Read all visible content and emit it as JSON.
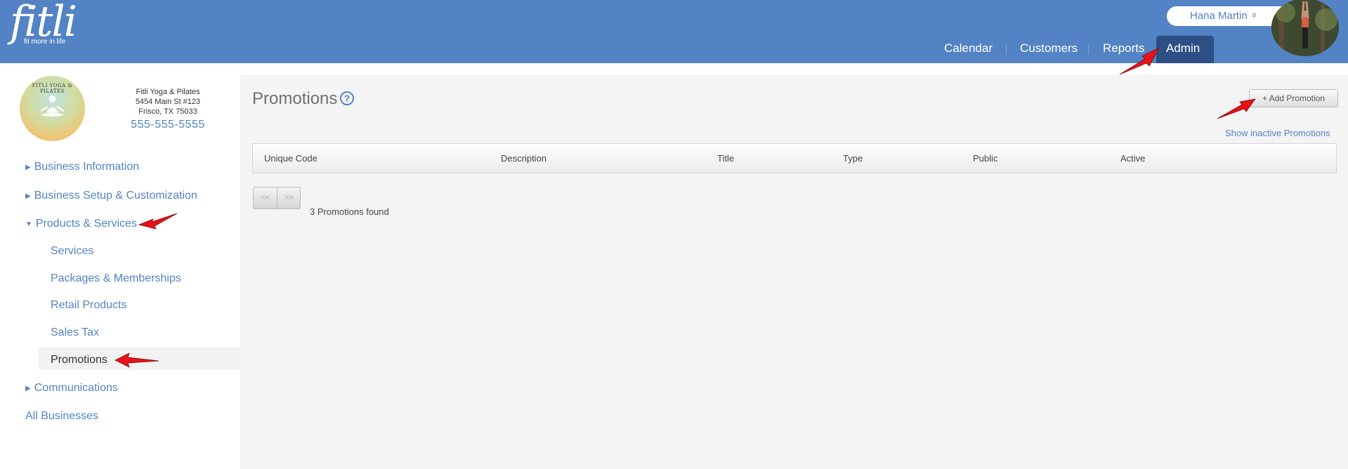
{
  "header": {
    "logo_word": "fitli",
    "logo_tagline": "fit more in life",
    "user_name": "Hana Martin",
    "user_chevron": "»",
    "nav": [
      {
        "label": "Calendar"
      },
      {
        "label": "Customers"
      },
      {
        "label": "Reports"
      },
      {
        "label": "Admin"
      }
    ]
  },
  "business": {
    "logo_text": "FITLI YOGA & PILATES",
    "name": "Fitli Yoga & Pilates",
    "address_line1": "5454 Main St #123",
    "address_line2": "Frisco, TX 75033",
    "phone": "555-555-5555"
  },
  "sidebar": {
    "items": [
      {
        "label": "Business Information"
      },
      {
        "label": "Business Setup & Customization"
      },
      {
        "label": "Products & Services"
      },
      {
        "label": "Communications"
      },
      {
        "label": "All Businesses"
      }
    ],
    "sub_items": [
      {
        "label": "Services"
      },
      {
        "label": "Packages & Memberships"
      },
      {
        "label": "Retail Products"
      },
      {
        "label": "Sales Tax"
      },
      {
        "label": "Promotions"
      }
    ]
  },
  "main": {
    "title": "Promotions",
    "help_glyph": "?",
    "add_button": "+ Add Promotion",
    "inactive_link": "Show inactive Promotions",
    "columns": [
      "Unique Code",
      "Description",
      "Title",
      "Type",
      "Public",
      "Active"
    ],
    "pager_prev": "<<",
    "pager_next": ">>",
    "found_text": "3 Promotions found"
  },
  "colors": {
    "header_bg": "#5383c4",
    "nav_active_bg": "#2d4f86",
    "link": "#5383c4",
    "annotation_arrow": "#e8121a"
  },
  "icons": [
    "help-icon",
    "caret-right-icon",
    "caret-down-icon",
    "chevron-double-down-icon"
  ]
}
